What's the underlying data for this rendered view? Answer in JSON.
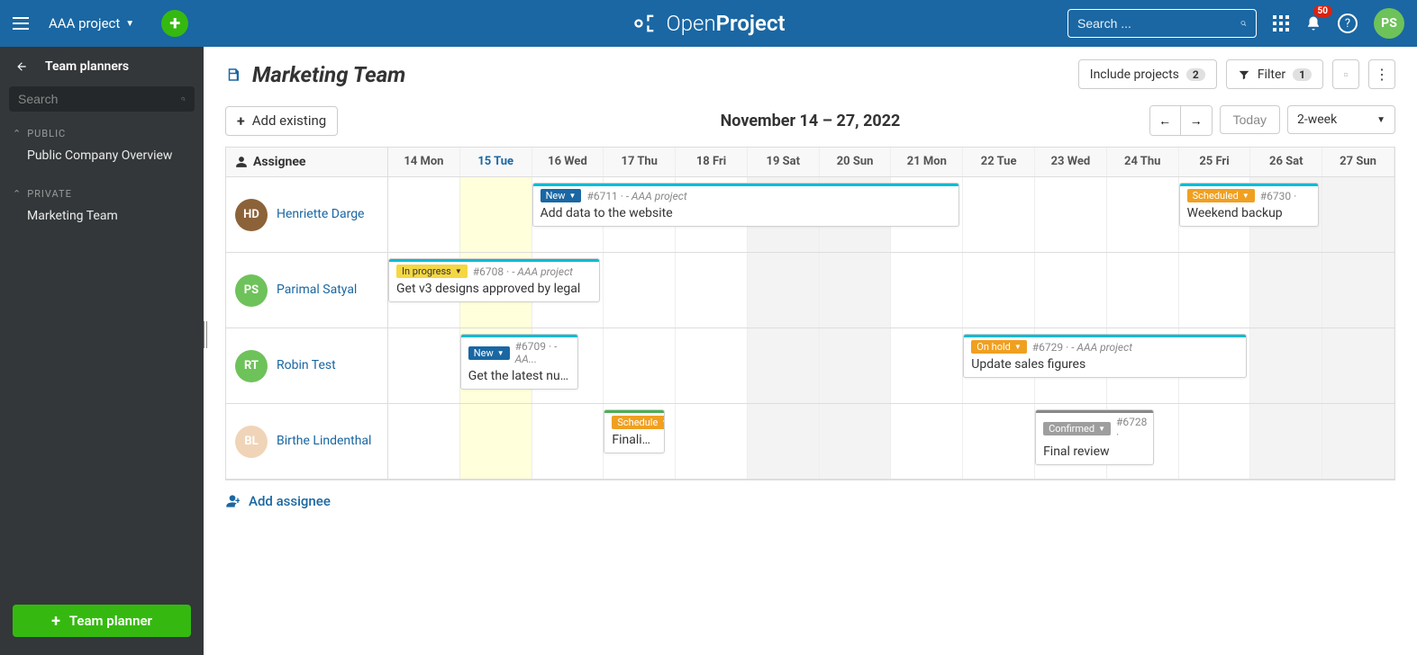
{
  "header": {
    "project_name": "AAA project",
    "search_placeholder": "Search ...",
    "notification_count": "50",
    "user_initials": "PS",
    "brand_light": "Open",
    "brand_bold": "Project"
  },
  "sidebar": {
    "back_title": "Team planners",
    "search_placeholder": "Search",
    "groups": {
      "public_label": "PUBLIC",
      "public_items": [
        "Public Company Overview"
      ],
      "private_label": "PRIVATE",
      "private_items": [
        "Marketing Team"
      ]
    },
    "create_button": "Team planner"
  },
  "toolbar": {
    "page_title": "Marketing Team",
    "include_projects_label": "Include projects",
    "include_projects_count": "2",
    "filter_label": "Filter",
    "filter_count": "1"
  },
  "subbar": {
    "add_existing": "Add existing",
    "date_range": "November 14 – 27, 2022",
    "today_label": "Today",
    "view_label": "2-week"
  },
  "days": [
    {
      "label": "14 Mon",
      "today": false,
      "weekend": false
    },
    {
      "label": "15 Tue",
      "today": true,
      "weekend": false
    },
    {
      "label": "16 Wed",
      "today": false,
      "weekend": false
    },
    {
      "label": "17 Thu",
      "today": false,
      "weekend": false
    },
    {
      "label": "18 Fri",
      "today": false,
      "weekend": false
    },
    {
      "label": "19 Sat",
      "today": false,
      "weekend": true
    },
    {
      "label": "20 Sun",
      "today": false,
      "weekend": true
    },
    {
      "label": "21 Mon",
      "today": false,
      "weekend": false
    },
    {
      "label": "22 Tue",
      "today": false,
      "weekend": false
    },
    {
      "label": "23 Wed",
      "today": false,
      "weekend": false
    },
    {
      "label": "24 Thu",
      "today": false,
      "weekend": false
    },
    {
      "label": "25 Fri",
      "today": false,
      "weekend": false
    },
    {
      "label": "26 Sat",
      "today": false,
      "weekend": true
    },
    {
      "label": "27 Sun",
      "today": false,
      "weekend": true
    }
  ],
  "assignee_header": "Assignee",
  "assignees": [
    {
      "name": "Henriette Darge",
      "avatar_bg": "#8c6239",
      "avatar_text": "HD",
      "cards": [
        {
          "start": 2,
          "span": 6,
          "status": "New",
          "status_bg": "#1A67A3",
          "id": "#6711",
          "project": "AAA project",
          "title": "Add data to the website",
          "bar": "#00bcd4"
        },
        {
          "start": 11,
          "span": 2,
          "status": "Scheduled",
          "status_bg": "#f0a020",
          "id": "#6730",
          "project": "",
          "title": "Weekend backup",
          "bar": "#00bcd4"
        }
      ]
    },
    {
      "name": "Parimal Satyal",
      "avatar_bg": "#6EC25A",
      "avatar_text": "PS",
      "cards": [
        {
          "start": 0,
          "span": 3,
          "status": "In progress",
          "status_bg": "#f5d742",
          "status_text": "#333",
          "id": "#6708",
          "project": "AAA project",
          "title": "Get v3 designs approved by legal",
          "bar": "#00bcd4"
        }
      ]
    },
    {
      "name": "Robin Test",
      "avatar_bg": "#6EC25A",
      "avatar_text": "RT",
      "cards": [
        {
          "start": 1,
          "span": 1.7,
          "status": "New",
          "status_bg": "#1A67A3",
          "id": "#6709",
          "project": "AA...",
          "title": "Get the latest numb...",
          "bar": "#00bcd4"
        },
        {
          "start": 8,
          "span": 4,
          "status": "On hold",
          "status_bg": "#f0a020",
          "id": "#6729",
          "project": "AAA project",
          "title": "Update sales figures",
          "bar": "#00bcd4"
        }
      ]
    },
    {
      "name": "Birthe Lindenthal",
      "avatar_bg": "#f0d4b8",
      "avatar_text": "BL",
      "cards": [
        {
          "start": 3,
          "span": 0.9,
          "status": "Schedule",
          "status_bg": "#f0a020",
          "id": "",
          "project": "",
          "title": "Finalise c",
          "bar": "#4caf50"
        },
        {
          "start": 9,
          "span": 1.7,
          "status": "Confirmed",
          "status_bg": "#9e9e9e",
          "id": "#6728",
          "project": "",
          "title": "Final review",
          "bar": "#888"
        }
      ]
    }
  ],
  "add_assignee": "Add assignee"
}
